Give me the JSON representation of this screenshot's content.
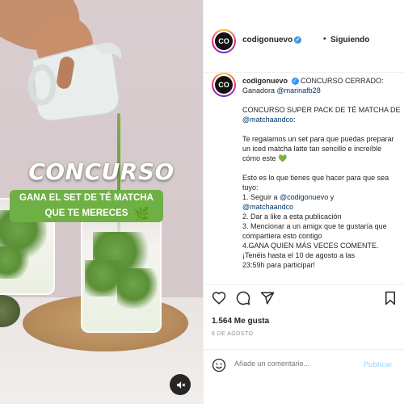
{
  "media": {
    "title": "CONCURSO",
    "banner_line1": "GANA EL SET DE TÉ MATCHA",
    "banner_line2": "QUE TE MERECES",
    "colors": {
      "banner": "#6fb044",
      "matcha": "#5f9a3a",
      "background": "#d9cdd0"
    },
    "mute_icon": "mute-speaker-icon"
  },
  "header": {
    "avatar_text": "CO",
    "username": "codigonuevo",
    "verified_icon": "verified-badge-icon",
    "dot": "•",
    "follow_status": "Siguiendo"
  },
  "caption": {
    "username": "codigonuevo",
    "line_1": "CONCURSO CERRADO:",
    "line_2_prefix": "Ganadora ",
    "winner_mention": "@marinafb28",
    "p2_text": "CONCURSO SUPER PACK DE TÉ MATCHA DE ",
    "p2_mention": "@matchaandco",
    "p2_suffix": ":",
    "p3_text": "Te regalamos un set para que puedas preparar un iced matcha latte tan sencillo e increíble cómo este",
    "green_heart": "💚",
    "p4_intro": "Esto es lo que tienes que hacer para que sea tuyo:",
    "step1_prefix": "1. Seguir a ",
    "step1_mention1": "@codigonuevo",
    "step1_middle": " y",
    "step1_mention2": "@matchaandco",
    "step2": "2. Dar a like a esta publicación",
    "step3": "3. Mencionar a un amigx que te gustaría que compartiera esto contigo",
    "step4": "4.GANA QUIEN MÁS VECES COMENTE.",
    "step5": "¡Tenéis hasta el 10 de agosto a las",
    "step6": "23:59h para participar!"
  },
  "actions": {
    "like_icon": "heart-icon",
    "comment_icon": "comment-bubble-icon",
    "share_icon": "paper-plane-icon",
    "save_icon": "bookmark-icon"
  },
  "stats": {
    "likes": "1.564 Me gusta",
    "date": "6 DE AGOSTO"
  },
  "comment": {
    "emoji_icon": "smiley-icon",
    "placeholder": "Añade un comentario...",
    "publish_label": "Publicar",
    "publish_color": "#b2dffc"
  }
}
